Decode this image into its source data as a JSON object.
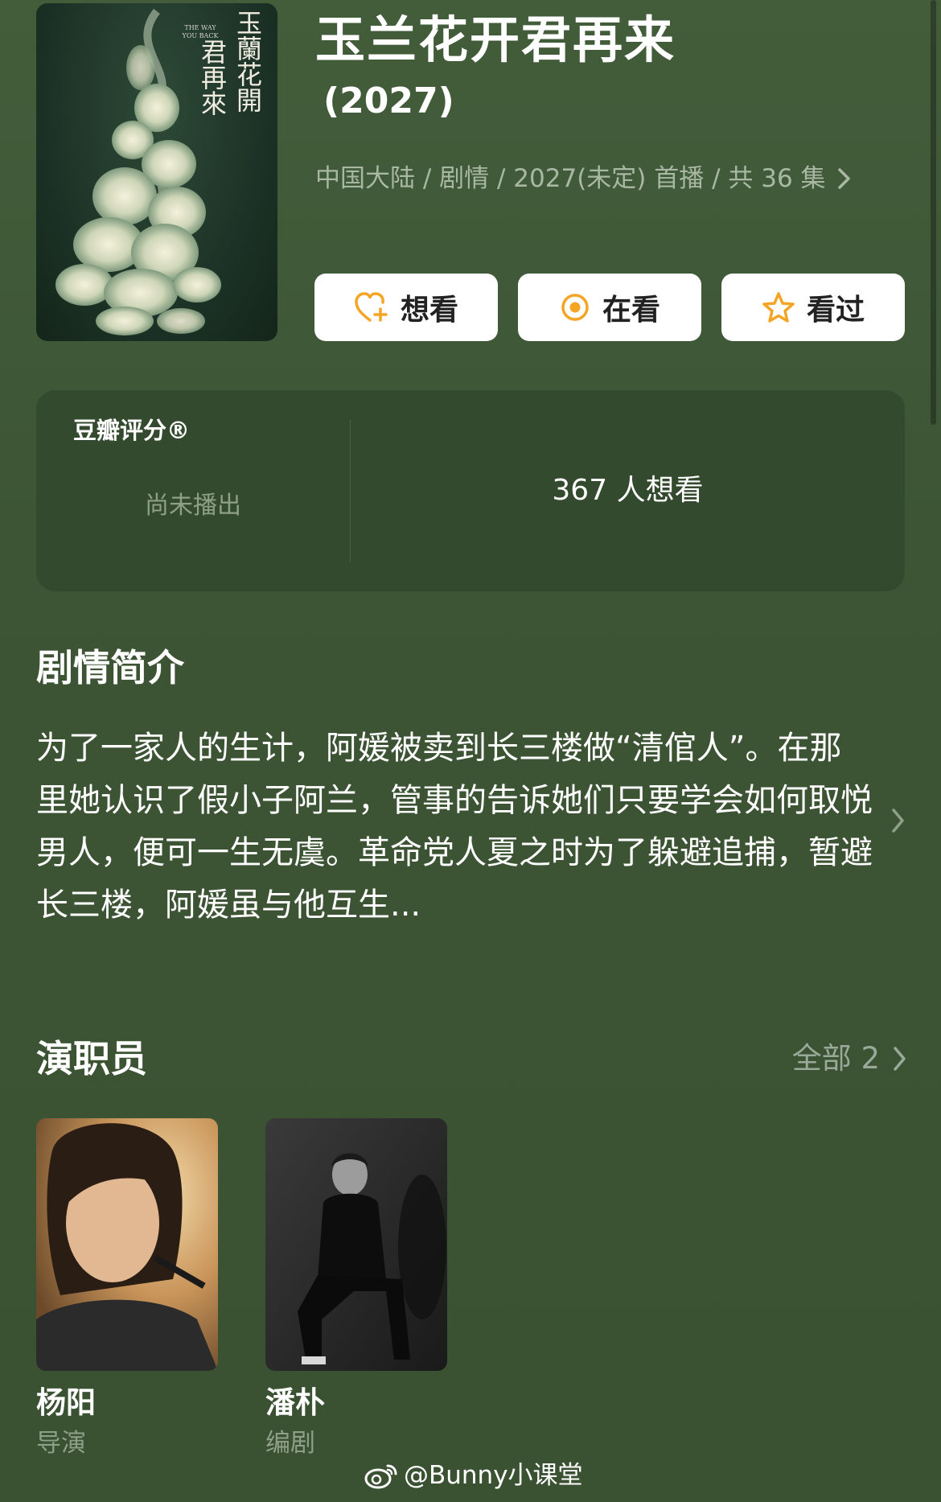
{
  "show": {
    "title": "玉兰花开君再来",
    "year": "(2027)",
    "meta": "中国大陆 / 剧情 / 2027(未定) 首播 / 共 36 集",
    "poster": {
      "title_cn_1": "玉蘭花開",
      "title_cn_2": "君再來",
      "title_en": "THE WAY YOU BACK"
    }
  },
  "actions": {
    "want_label": "想看",
    "watching_label": "在看",
    "watched_label": "看过"
  },
  "rating": {
    "label": "豆瓣评分®",
    "status": "尚未播出",
    "want_count": "367 人想看"
  },
  "synopsis": {
    "title": "剧情简介",
    "text": "为了一家人的生计，阿媛被卖到长三楼做“清倌人”。在那里她认识了假小子阿兰，管事的告诉她们只要学会如何取悦男人，便可一生无虞。革命党人夏之时为了躲避追捕，暂避长三楼，阿媛虽与他互生..."
  },
  "cast": {
    "title": "演职员",
    "view_all": "全部 2",
    "people": [
      {
        "name": "杨阳",
        "role": "导演"
      },
      {
        "name": "潘朴",
        "role": "编剧"
      }
    ]
  },
  "watermark": "@Bunny小课堂",
  "colors": {
    "background": "#3d5535",
    "card": "#344a2e",
    "accent_orange": "#f5a524",
    "muted_text": "#a9b8a2"
  }
}
